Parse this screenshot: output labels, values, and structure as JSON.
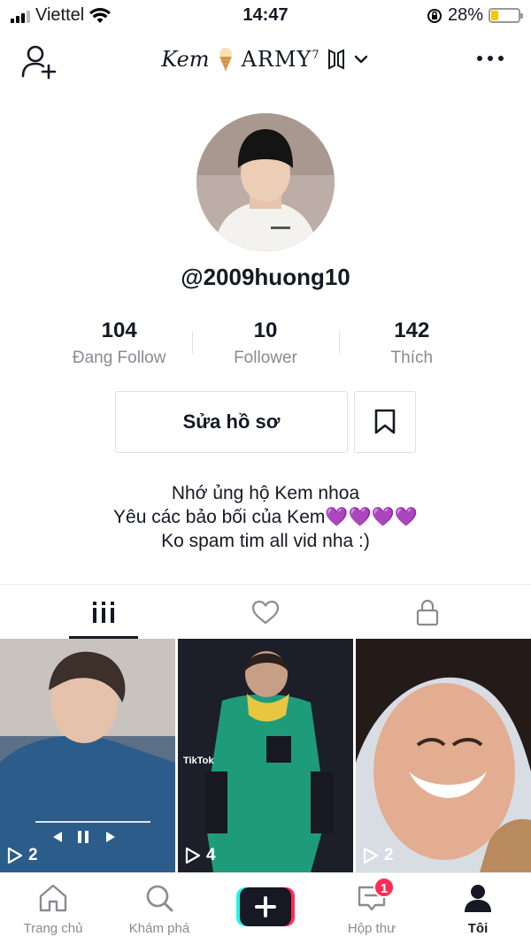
{
  "status_bar": {
    "carrier": "Viettel",
    "time": "14:47",
    "battery_percent": "28%",
    "battery_level": 0.28
  },
  "header": {
    "title_name": "Kem",
    "title_icon": "ice-cream-icon",
    "title_army": "ARMY",
    "title_superscript": "7"
  },
  "profile": {
    "username": "@2009huong10"
  },
  "stats": [
    {
      "value": "104",
      "label": "Đang Follow"
    },
    {
      "value": "10",
      "label": "Follower"
    },
    {
      "value": "142",
      "label": "Thích"
    }
  ],
  "actions": {
    "edit_label": "Sửa hồ sơ"
  },
  "bio": {
    "line1": "Nhớ ủng hộ Kem nhoa",
    "line2": "Yêu các bảo bối của Kem💜💜💜💜",
    "line3": "Ko spam tim all vid nha :)"
  },
  "tabs": [
    "videos-icon",
    "liked-icon",
    "private-icon"
  ],
  "videos": [
    {
      "views": "2"
    },
    {
      "views": "4",
      "watermark": "TikTok"
    },
    {
      "views": "2"
    }
  ],
  "bottom_nav": {
    "home": "Trang chủ",
    "discover": "Khám phá",
    "inbox": "Hộp thư",
    "inbox_badge": "1",
    "me": "Tôi"
  },
  "colors": {
    "accent_red": "#fe2c55",
    "accent_cyan": "#25f4ee",
    "text": "#161823",
    "muted": "#8a8b91"
  }
}
